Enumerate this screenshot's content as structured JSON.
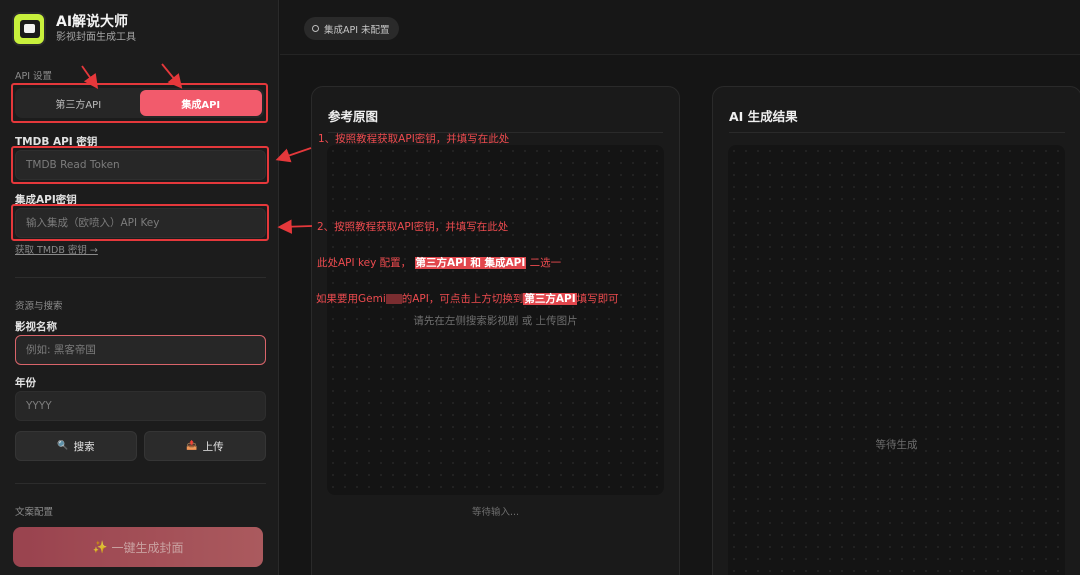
{
  "brand": {
    "title": "AI解说大师",
    "subtitle": "影视封面生成工具"
  },
  "sidebar": {
    "api_section": "API 设置",
    "api_options": [
      "第三方API",
      "集成API"
    ],
    "tmdb_label": "TMDB API 密钥",
    "tmdb_placeholder": "TMDB Read Token",
    "integrated_label": "集成API密钥",
    "integrated_placeholder": "输入集成（欧喷入）API Key",
    "tmdb_link": "获取 TMDB 密钥 →",
    "resource_section": "资源与搜索",
    "title_label": "影视名称",
    "title_placeholder": "例如: 黑客帝国",
    "year_label": "年份",
    "year_placeholder": "YYYY",
    "search_button": "搜索",
    "upload_button": "上传",
    "copy_section": "文案配置",
    "generate_button": "一键生成封面"
  },
  "topbar": {
    "status": "集成API 未配置"
  },
  "panels": {
    "reference": {
      "title": "参考原图",
      "hint": "请先在左侧搜索影视剧 或 上传图片",
      "footer": "等待输入..."
    },
    "result": {
      "title": "AI 生成结果",
      "hint": "等待生成"
    }
  },
  "annotations": {
    "note1": "1、按照教程获取API密钥，并填写在此处",
    "note2": "2、按照教程获取API密钥，并填写在此处",
    "note3_pre": "此处API key 配置，",
    "note3_hl": "第三方API 和 集成API",
    "note3_post": "二选一",
    "note4_pre": "如果要用Gemi",
    "note4_mid": "的API，可点击上方切换到",
    "note4_hl": "第三方API",
    "note4_post": "填写即可"
  },
  "colors": {
    "accent": "#f25b6c",
    "annotation": "#e5383b",
    "logo": "#c8f03c"
  }
}
